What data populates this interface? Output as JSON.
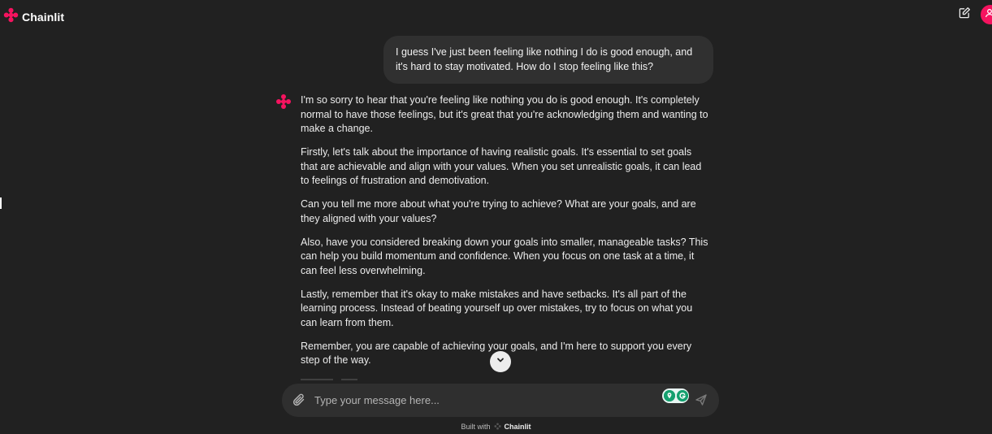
{
  "header": {
    "app_name": "Chainlit",
    "brand_icon": "chainlit-logo-icon",
    "new_chat_icon": "edit-icon",
    "avatar_icon": "user-icon"
  },
  "conversation": {
    "user_message": "I guess I've just been feeling like nothing I do is good enough, and it's hard to stay motivated. How do I stop feeling like this?",
    "assistant_paragraphs": [
      "I'm so sorry to hear that you're feeling like nothing you do is good enough. It's completely normal to have those feelings, but it's great that you're acknowledging them and wanting to make a change.",
      "Firstly, let's talk about the importance of having realistic goals. It's essential to set goals that are achievable and align with your values. When you set unrealistic goals, it can lead to feelings of frustration and demotivation.",
      "Can you tell me more about what you're trying to achieve? What are your goals, and are they aligned with your values?",
      "Also, have you considered breaking down your goals into smaller, manageable tasks? This can help you build momentum and confidence. When you focus on one task at a time, it can feel less overwhelming.",
      "Lastly, remember that it's okay to make mistakes and have setbacks. It's all part of the learning process. Instead of beating yourself up over mistakes, try to focus on what you can learn from them.",
      "Remember, you are capable of achieving your goals, and I'm here to support you every step of the way."
    ]
  },
  "composer": {
    "placeholder": "Type your message here...",
    "attach_icon": "paperclip-icon",
    "send_icon": "send-icon",
    "extension_badges": [
      "location-pin-icon",
      "grammarly-icon"
    ]
  },
  "footer": {
    "built_with": "Built with",
    "brand": "Chainlit"
  },
  "colors": {
    "background": "#212121",
    "bubble": "#303030",
    "accent": "#f5135f"
  }
}
